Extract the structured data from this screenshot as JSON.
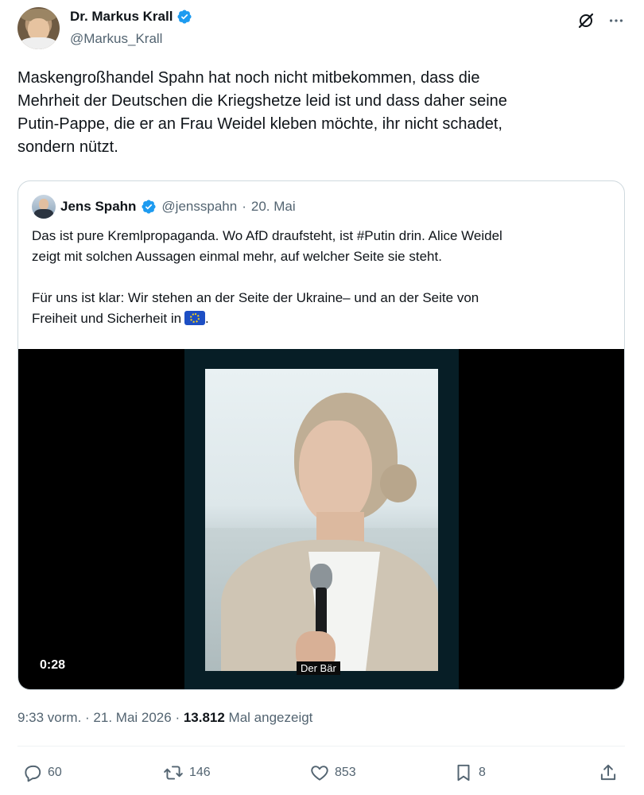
{
  "tweet": {
    "author": {
      "display_name": "Dr. Markus Krall",
      "handle": "@Markus_Krall",
      "verified": true
    },
    "text_lines": [
      "Maskengroßhandel Spahn hat noch nicht mitbekommen, dass die",
      "Mehrheit der Deutschen die Kriegshetze leid ist und dass daher seine",
      "Putin-Pappe, die er an Frau Weidel kleben möchte, ihr nicht schadet,",
      "sondern nützt."
    ],
    "quote": {
      "author": {
        "display_name": "Jens Spahn",
        "handle": "@jensspahn",
        "verified": true
      },
      "separator": "·",
      "date": "20. Mai",
      "paragraph1_lines": [
        "Das ist pure Kremlpropaganda. Wo AfD draufsteht, ist #Putin drin. Alice Weidel",
        "zeigt mit solchen Aussagen einmal mehr, auf welcher Seite sie steht."
      ],
      "paragraph2_lines": [
        "Für uns ist klar: Wir stehen an der Seite der Ukraine– und an der Seite von",
        "Freiheit und Sicherheit in"
      ],
      "paragraph2_end": ".",
      "flag_icon": "eu-flag-icon",
      "video": {
        "duration": "0:28",
        "caption": "Der Bär"
      }
    },
    "meta": {
      "time": "9:33 vorm.",
      "sep1": " · ",
      "date": "21. Mai 2026",
      "sep2": " · ",
      "views": "13.812",
      "views_label": " Mal angezeigt"
    },
    "actions": {
      "replies": "60",
      "retweets": "146",
      "likes": "853",
      "bookmarks": "8"
    },
    "colors": {
      "verified_blue": "#1d9bf0",
      "secondary_text": "#536471",
      "primary_text": "#0f1419",
      "border": "#cfd9de"
    },
    "icons": [
      "verified-badge-icon",
      "grok-icon",
      "more-icon",
      "reply-icon",
      "retweet-icon",
      "like-icon",
      "bookmark-icon",
      "share-icon"
    ]
  }
}
